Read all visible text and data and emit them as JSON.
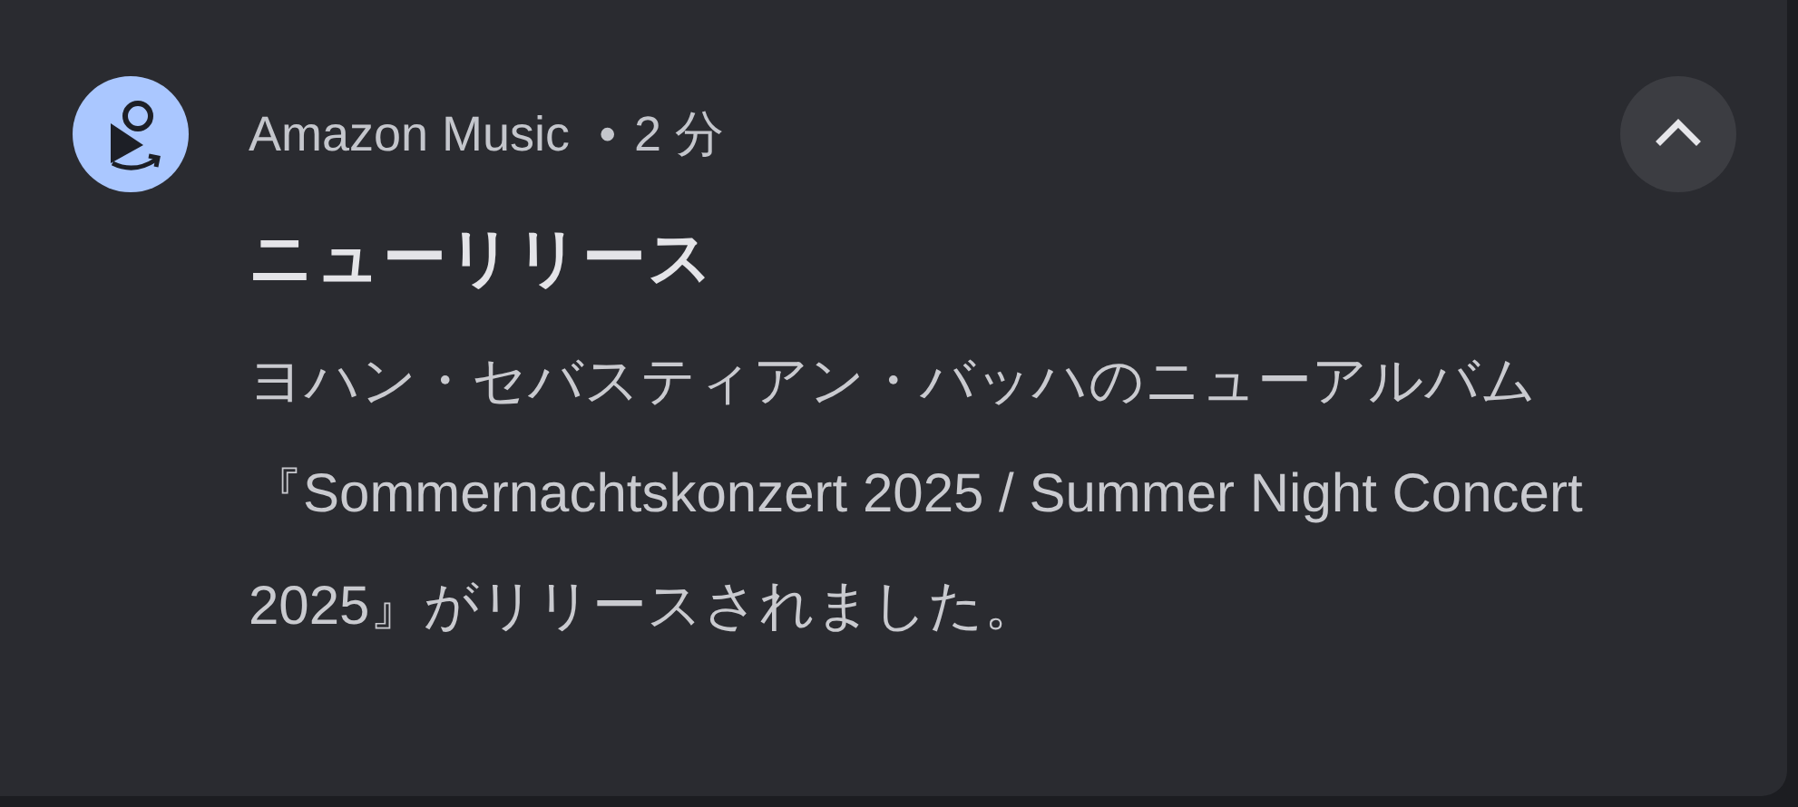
{
  "notification": {
    "app_name": "Amazon Music",
    "separator": "•",
    "time": "2 分",
    "expanded": true,
    "title": "ニューリリース",
    "body": "ヨハン・セバスティアン・バッハのニューアルバム『Sommernachtskonzert 2025 / Summer Night Concert 2025』がリリースされました。"
  }
}
